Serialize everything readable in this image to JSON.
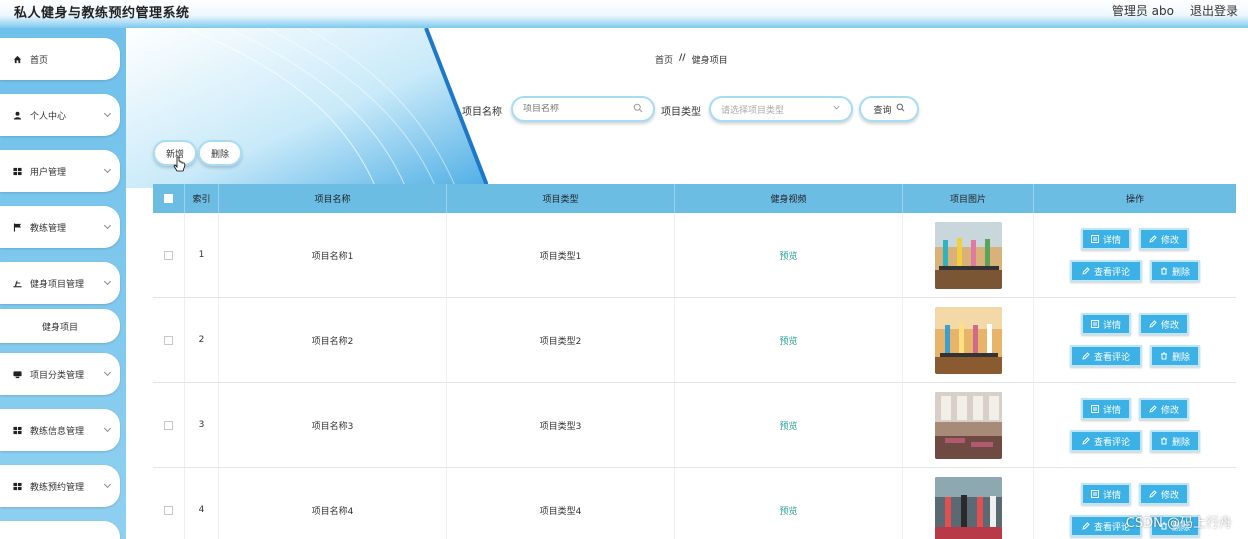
{
  "app": {
    "title": "私人健身与教练预约管理系统"
  },
  "header": {
    "user_text": "管理员 abo",
    "logout": "退出登录"
  },
  "sidebar": {
    "items": [
      {
        "label": "首页",
        "icon": "home-icon"
      },
      {
        "label": "个人中心",
        "icon": "user-icon"
      },
      {
        "label": "用户管理",
        "icon": "grid-icon"
      },
      {
        "label": "教练管理",
        "icon": "flag-icon"
      },
      {
        "label": "健身项目管理",
        "icon": "dumbbell-icon"
      },
      {
        "label": "健身项目",
        "icon": ""
      },
      {
        "label": "项目分类管理",
        "icon": "folder-icon"
      },
      {
        "label": "教练信息管理",
        "icon": "grid-icon"
      },
      {
        "label": "教练预约管理",
        "icon": "grid-icon"
      }
    ]
  },
  "breadcrumb": {
    "home": "首页",
    "sep": "//",
    "current": "健身项目"
  },
  "search": {
    "name_label": "项目名称",
    "name_placeholder": "项目名称",
    "type_label": "项目类型",
    "type_placeholder": "请选择项目类型",
    "query_button": "查询"
  },
  "actions": {
    "add": "新增",
    "delete": "删除"
  },
  "table": {
    "headers": [
      "索引",
      "项目名称",
      "项目类型",
      "健身视频",
      "项目图片",
      "操作"
    ],
    "rows": [
      {
        "index": "1",
        "name": "项目名称1",
        "type": "项目类型1",
        "video": "预览"
      },
      {
        "index": "2",
        "name": "项目名称2",
        "type": "项目类型2",
        "video": "预览"
      },
      {
        "index": "3",
        "name": "项目名称3",
        "type": "项目类型3",
        "video": "预览"
      },
      {
        "index": "4",
        "name": "项目名称4",
        "type": "项目类型4",
        "video": "预览"
      }
    ],
    "ops": {
      "detail": "详情",
      "edit": "修改",
      "comments": "查看评论",
      "delete": "删除"
    }
  },
  "watermark": "CSDN @码上行舟",
  "colors": {
    "accent": "#3bb1e6",
    "header_bg": "#6cbde4",
    "sidebar_bg": "#7cc9ef"
  }
}
